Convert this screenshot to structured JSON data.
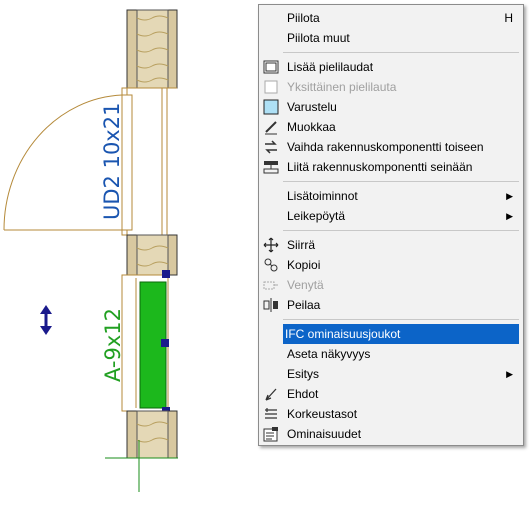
{
  "drawing": {
    "door_tag": "UD2 10x21",
    "window_tag": "A-9x12"
  },
  "menu": {
    "items": [
      {
        "label": "Piilota",
        "shortcut": "H"
      },
      {
        "label": "Piilota muut"
      },
      {
        "label": "Lisää pielilaudat",
        "icon": "add-jamb-boards-icon"
      },
      {
        "label": "Yksittäinen pielilauta",
        "icon": "single-jamb-board-icon",
        "disabled": true
      },
      {
        "label": "Varustelu",
        "icon": "equipment-icon"
      },
      {
        "label": "Muokkaa",
        "icon": "edit-icon"
      },
      {
        "label": "Vaihda rakennuskomponentti toiseen",
        "icon": "swap-component-icon"
      },
      {
        "label": "Liitä rakennuskomponentti seinään",
        "icon": "attach-to-wall-icon"
      },
      {
        "label": "Lisätoiminnot",
        "submenu": true
      },
      {
        "label": "Leikepöytä",
        "submenu": true
      },
      {
        "label": "Siirrä",
        "icon": "move-icon"
      },
      {
        "label": "Kopioi",
        "icon": "copy-icon"
      },
      {
        "label": "Venytä",
        "icon": "stretch-icon",
        "disabled": true
      },
      {
        "label": "Peilaa",
        "icon": "mirror-icon"
      },
      {
        "label": "IFC ominaisuusjoukot",
        "highlighted": true
      },
      {
        "label": "Aseta näkyvyys"
      },
      {
        "label": "Esitys",
        "submenu": true
      },
      {
        "label": "Ehdot",
        "icon": "conditions-icon"
      },
      {
        "label": "Korkeustasot",
        "icon": "height-levels-icon"
      },
      {
        "label": "Ominaisuudet",
        "icon": "properties-icon"
      }
    ]
  },
  "colors": {
    "highlight": "#0c64c8",
    "door_tag": "#1a55b0",
    "window_tag": "#22a022",
    "glass": "#1cb81c",
    "grip": "#1a1a8c",
    "wall_fill": "#d8c8a0",
    "frame": "#b58a3a"
  }
}
